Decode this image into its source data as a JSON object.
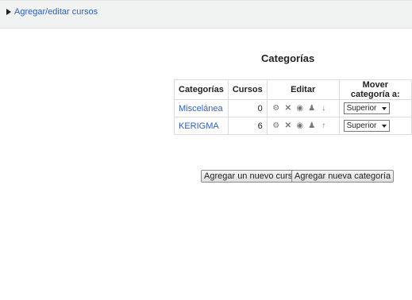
{
  "breadcrumb": {
    "label": "Agregar/editar cursos"
  },
  "heading": "Categorías",
  "table": {
    "headers": [
      "Categorías",
      "Cursos",
      "Editar",
      "Mover categoría a:"
    ],
    "rows": [
      {
        "name": "Miscelánea",
        "courses": "0",
        "move_to": "Superior",
        "arrow_icon": "arrow-down-icon"
      },
      {
        "name": "KERIGMA",
        "courses": "6",
        "move_to": "Superior",
        "arrow_icon": "arrow-up-icon"
      }
    ],
    "edit_icons": [
      "settings-icon",
      "delete-icon",
      "hide-icon",
      "assign-roles-icon"
    ]
  },
  "buttons": {
    "add_course": "Agregar un nuevo curso",
    "add_category": "Agregar nueva categoría"
  },
  "colors": {
    "link": "#2a5fc8",
    "topbar": "#f1f2f2"
  }
}
